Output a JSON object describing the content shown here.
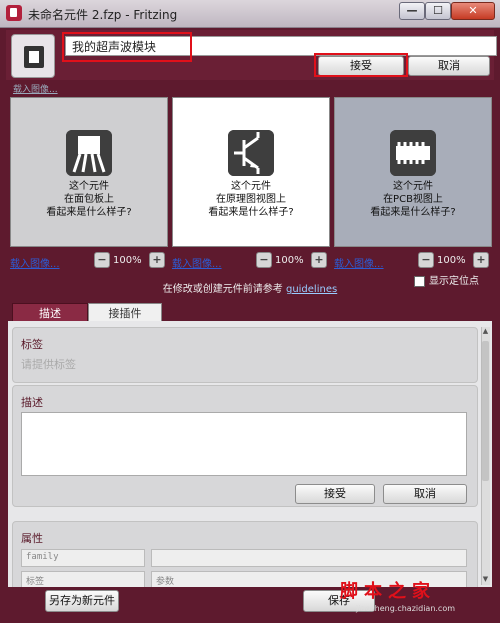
{
  "window": {
    "title": "未命名元件 2.fzp - Fritzing",
    "minimize": "—",
    "maximize": "☐",
    "close": "✕"
  },
  "header": {
    "title_value": "我的超声波模块",
    "accept": "接受",
    "cancel": "取消",
    "load_image": "载入图像..."
  },
  "views": [
    {
      "name": "breadboard",
      "text": [
        "这个元件",
        "在面包板上",
        "看起来是什么样子?"
      ],
      "load": "载入图像...",
      "zoom": "100%",
      "minus": "−",
      "plus": "+"
    },
    {
      "name": "schematic",
      "text": [
        "这个元件",
        "在原理图视图上",
        "看起来是什么样子?"
      ],
      "load": "载入图像...",
      "zoom": "100%",
      "minus": "−",
      "plus": "+"
    },
    {
      "name": "pcb",
      "text": [
        "这个元件",
        "在PCB视图上",
        "看起来是什么样子?"
      ],
      "load": "载入图像...",
      "zoom": "100%",
      "minus": "−",
      "plus": "+"
    }
  ],
  "note": {
    "text": "在修改或创建元件前请参考",
    "link": "guidelines"
  },
  "show_anchors": "显示定位点",
  "tabs": {
    "desc": "描述",
    "conn": "接插件"
  },
  "tags": {
    "title": "标签",
    "placeholder": "请提供标签"
  },
  "desc": {
    "title": "描述",
    "accept": "接受",
    "cancel": "取消"
  },
  "props": {
    "title": "属性",
    "row1_key": "family",
    "row2_key": "标签",
    "row2_val": "参数"
  },
  "footer": {
    "save_new": "另存为新元件",
    "save": "保存"
  },
  "watermark": {
    "main": "脚本之家",
    "sub": "jiaocheng.chazidian.com"
  },
  "colors": {
    "accent": "#6a1f35",
    "highlight": "#e0101a",
    "link": "#2d5bd4"
  }
}
